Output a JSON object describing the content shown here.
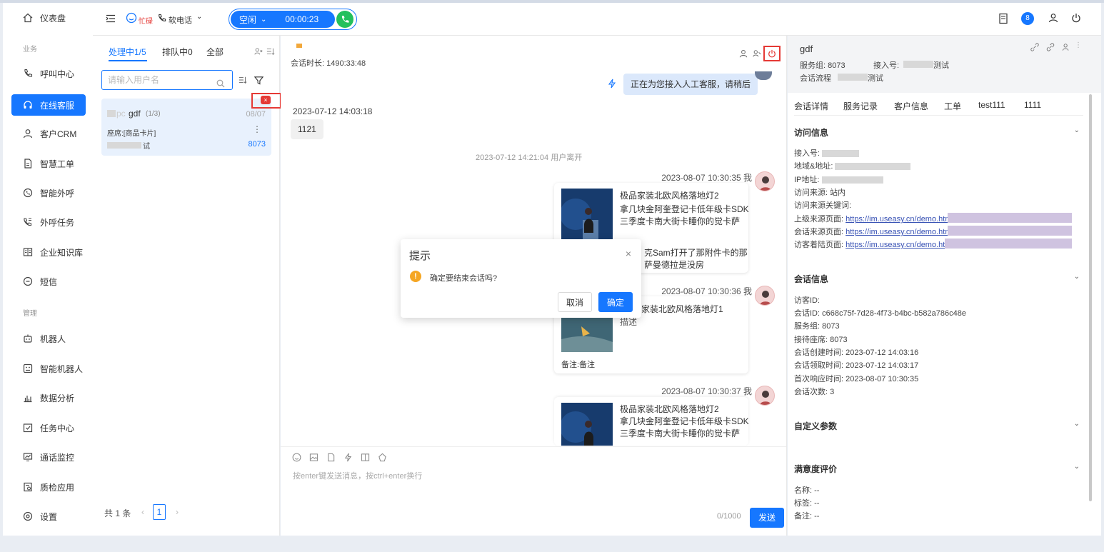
{
  "sidebar": {
    "top_item": {
      "label": "仪表盘",
      "icon": "home-icon"
    },
    "group_business": "业务",
    "group_manage": "管理",
    "items": [
      {
        "label": "呼叫中心",
        "icon": "phone-icon"
      },
      {
        "label": "在线客服",
        "icon": "headset-icon",
        "active": true
      },
      {
        "label": "客户CRM",
        "icon": "user-icon"
      },
      {
        "label": "智慧工单",
        "icon": "document-icon"
      },
      {
        "label": "智能外呼",
        "icon": "whatsapp-icon"
      },
      {
        "label": "外呼任务",
        "icon": "phone-out-icon"
      },
      {
        "label": "企业知识库",
        "icon": "book-icon"
      },
      {
        "label": "短信",
        "icon": "sms-icon"
      }
    ],
    "manage_items": [
      {
        "label": "机器人",
        "icon": "robot-icon"
      },
      {
        "label": "智能机器人",
        "icon": "smart-robot-icon"
      },
      {
        "label": "数据分析",
        "icon": "bar-chart-icon"
      },
      {
        "label": "任务中心",
        "icon": "task-icon"
      },
      {
        "label": "通话监控",
        "icon": "monitor-icon"
      },
      {
        "label": "质检应用",
        "icon": "quality-icon"
      },
      {
        "label": "设置",
        "icon": "settings-icon"
      }
    ]
  },
  "topbar": {
    "status_busy": "忙碌",
    "softphone": "软电话",
    "call_status": "空闲",
    "call_timer": "00:00:23",
    "badge_count": "8"
  },
  "list": {
    "tabs": [
      "处理中1/5",
      "排队中0",
      "全部"
    ],
    "search_placeholder": "请输入用户名",
    "conversation": {
      "name_prefix": "pc",
      "name": "gdf",
      "count": "(1/3)",
      "date": "08/07",
      "sub": "座席:[商品卡片]",
      "suffix": "试",
      "group": "8073"
    },
    "total": "共 1 条",
    "page": "1"
  },
  "chat": {
    "duration": "会话时长: 1490:33:48",
    "system_msg": "正在为您接入人工客服，请稍后",
    "msg1_time": "2023-07-12 14:03:18",
    "msg1_text": "1121",
    "leave_notice": "2023-07-12 14:21:04 用户离开",
    "card1": {
      "time": "2023-08-07 10:30:35 我",
      "title": "极品家装北欧风格落地灯2",
      "line2": "拿几块金阿奎登记卡低年级卡SDK",
      "line3": "三季度卡南大街卡睡你的觉卡萨",
      "line4": "克Sam打开了那附件卡的那",
      "line5": "萨曼德拉是没房"
    },
    "card2": {
      "time": "2023-08-07 10:30:36 我",
      "title": "家装北欧风格落地灯1",
      "desc": "描述",
      "note": "备注:备注"
    },
    "card3": {
      "time": "2023-08-07 10:30:37 我",
      "title": "极品家装北欧风格落地灯2",
      "line2": "拿几块金阿奎登记卡低年级卡SDK",
      "line3": "三季度卡南大街卡睡你的觉卡萨"
    },
    "input_placeholder": "按enter键发送消息，按ctrl+enter换行",
    "counter": "0/1000",
    "send": "发送"
  },
  "dialog": {
    "title": "提示",
    "message": "确定要结束会话吗?",
    "cancel": "取消",
    "confirm": "确定"
  },
  "info": {
    "name": "gdf",
    "service_group": "服务组: 8073",
    "access_label": "接入号:",
    "access_suffix": "测试",
    "flow_label": "会话流程",
    "flow_suffix": "测试",
    "tabs": [
      "会话详情",
      "服务记录",
      "客户信息",
      "工单",
      "test111",
      "1111"
    ],
    "visit_title": "访问信息",
    "visit_rows": {
      "access": "接入号:",
      "region": "地域&地址:",
      "ip": "IP地址:",
      "source": "访问来源: 站内",
      "keyword": "访问来源关键词:",
      "referer_label": "上级来源页面:",
      "referer_link": "https://im.useasy.cn/demo.htm",
      "origin_label": "会话来源页面:",
      "origin_link": "https://im.useasy.cn/demo.htm",
      "landing_label": "访客着陆页面:",
      "landing_link": "https://im.useasy.cn/demo.htm"
    },
    "session_title": "会话信息",
    "session_rows": [
      "访客ID:",
      "会话ID: c668c75f-7d28-4f73-b4bc-b582a786c48e",
      "服务组: 8073",
      "接待座席: 8073",
      "会话创建时间: 2023-07-12 14:03:16",
      "会话领取时间: 2023-07-12 14:03:17",
      "首次响应时间: 2023-08-07 10:30:35",
      "会话次数: 3"
    ],
    "custom_title": "自定义参数",
    "satisfaction_title": "满意度评价",
    "satisfaction_rows": [
      "名称: --",
      "标签: --",
      "备注: --"
    ]
  }
}
